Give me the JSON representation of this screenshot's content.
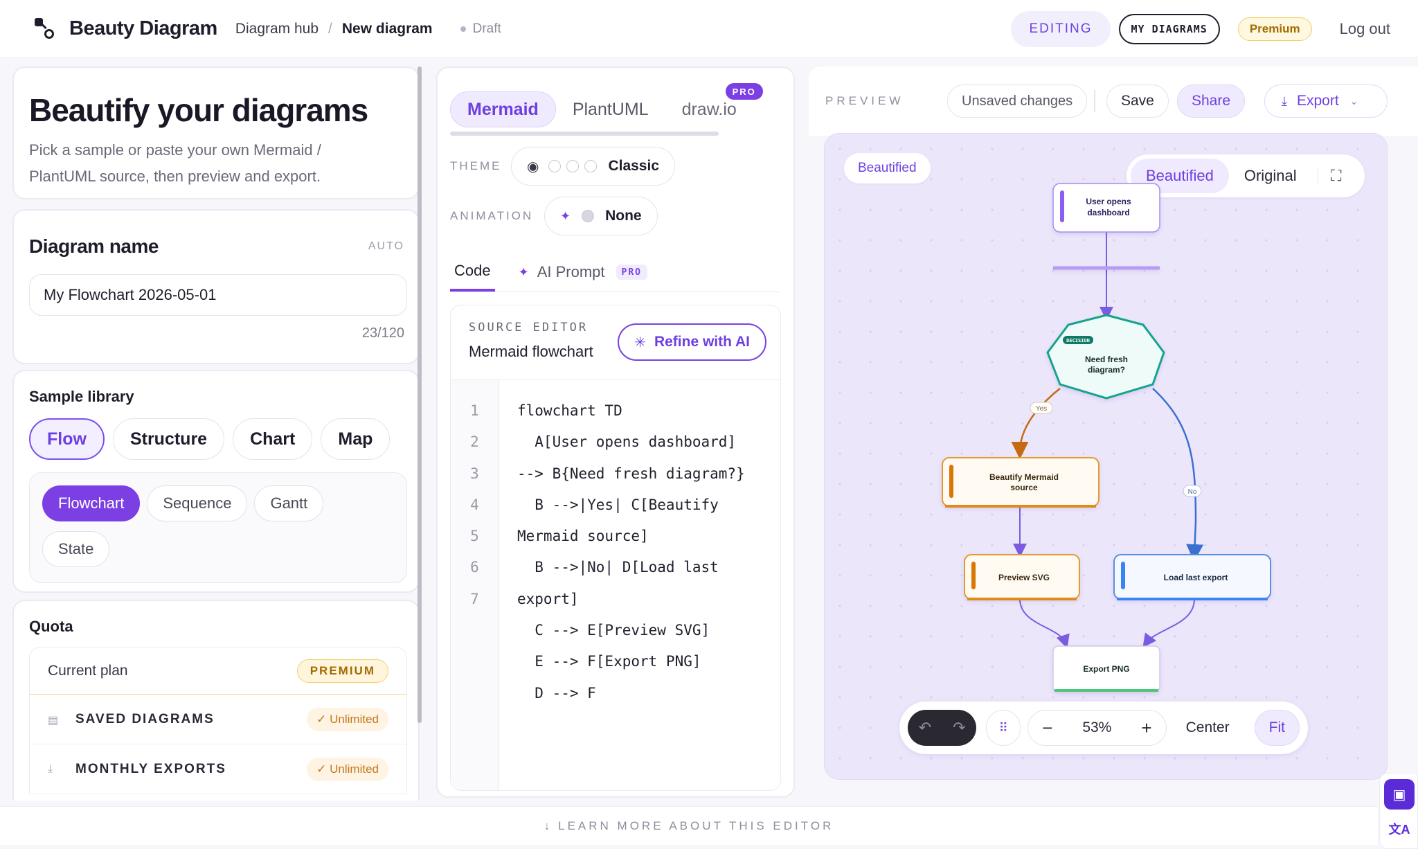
{
  "header": {
    "app_name": "Beauty Diagram",
    "breadcrumb": [
      "Diagram hub",
      "/",
      "New diagram"
    ],
    "status": "Draft",
    "editing_label": "EDITING",
    "my_diagrams_label": "MY DIAGRAMS",
    "plan_badge": "Premium",
    "logout_label": "Log out"
  },
  "intro": {
    "title": "Beautify your diagrams",
    "description": "Pick a sample or paste your own Mermaid / PlantUML source, then preview and export."
  },
  "diagram_name": {
    "title": "Diagram name",
    "hint": "AUTO",
    "value": "My Flowchart 2026-05-01",
    "counter": "23/120"
  },
  "samples": {
    "title": "Sample library",
    "categories": [
      "Flow",
      "Structure",
      "Chart",
      "Map"
    ],
    "active_category": "Flow",
    "types": [
      "Flowchart",
      "Sequence",
      "Gantt",
      "State"
    ],
    "active_type": "Flowchart"
  },
  "quota": {
    "title": "Quota",
    "plan_label": "Current plan",
    "plan_value": "PREMIUM",
    "items": [
      {
        "label": "SAVED DIAGRAMS",
        "value": "✓ Unlimited",
        "icon": "document-icon"
      },
      {
        "label": "MONTHLY EXPORTS",
        "value": "✓ Unlimited",
        "icon": "download-icon"
      }
    ]
  },
  "editor": {
    "syntax_tabs": [
      "Mermaid",
      "PlantUML",
      "draw.io"
    ],
    "active_syntax": "Mermaid",
    "pro_badge": "PRO",
    "theme_label": "THEME",
    "theme_value": "Classic",
    "animation_label": "ANIMATION",
    "animation_value": "None",
    "code_tabs": [
      "Code",
      "AI Prompt"
    ],
    "active_code_tab": "Code",
    "ai_pro_badge": "PRO",
    "source_kicker": "SOURCE EDITOR",
    "source_title": "Mermaid flowchart",
    "refine_label": "Refine with AI",
    "line_numbers": [
      "1",
      "2",
      "3",
      "4",
      "5",
      "6",
      "7"
    ],
    "code_lines": [
      "flowchart TD",
      "  A[User opens dashboard]",
      "--> B{Need fresh diagram?}",
      "  B -->|Yes| C[Beautify",
      "Mermaid source]",
      "  B -->|No| D[Load last",
      "export]",
      "  C --> E[Preview SVG]",
      "  E --> F[Export PNG]",
      "  D --> F"
    ]
  },
  "preview": {
    "label": "PREVIEW",
    "unsaved": "Unsaved changes",
    "save": "Save",
    "share": "Share",
    "export": "Export",
    "badge": "Beautified",
    "view_options": [
      "Beautified",
      "Original"
    ],
    "active_view": "Beautified",
    "zoom": "53%",
    "center": "Center",
    "fit": "Fit",
    "nodes": {
      "a": [
        "User opens",
        "dashboard"
      ],
      "b_tag": "DECISION",
      "b": [
        "Need fresh",
        "diagram?"
      ],
      "c": [
        "Beautify Mermaid",
        "source"
      ],
      "d": "Load last export",
      "e": "Preview SVG",
      "f": "Export PNG"
    },
    "edge_labels": {
      "yes": "Yes",
      "no": "No"
    },
    "colors": {
      "accent": "#7b3fe4",
      "node_a": "#8b5cf6",
      "node_b": "#14a38b",
      "node_c": "#d97706",
      "node_d": "#3b82f6",
      "node_f": "#22c55e"
    }
  },
  "footer": {
    "label": "LEARN MORE ABOUT THIS EDITOR"
  }
}
